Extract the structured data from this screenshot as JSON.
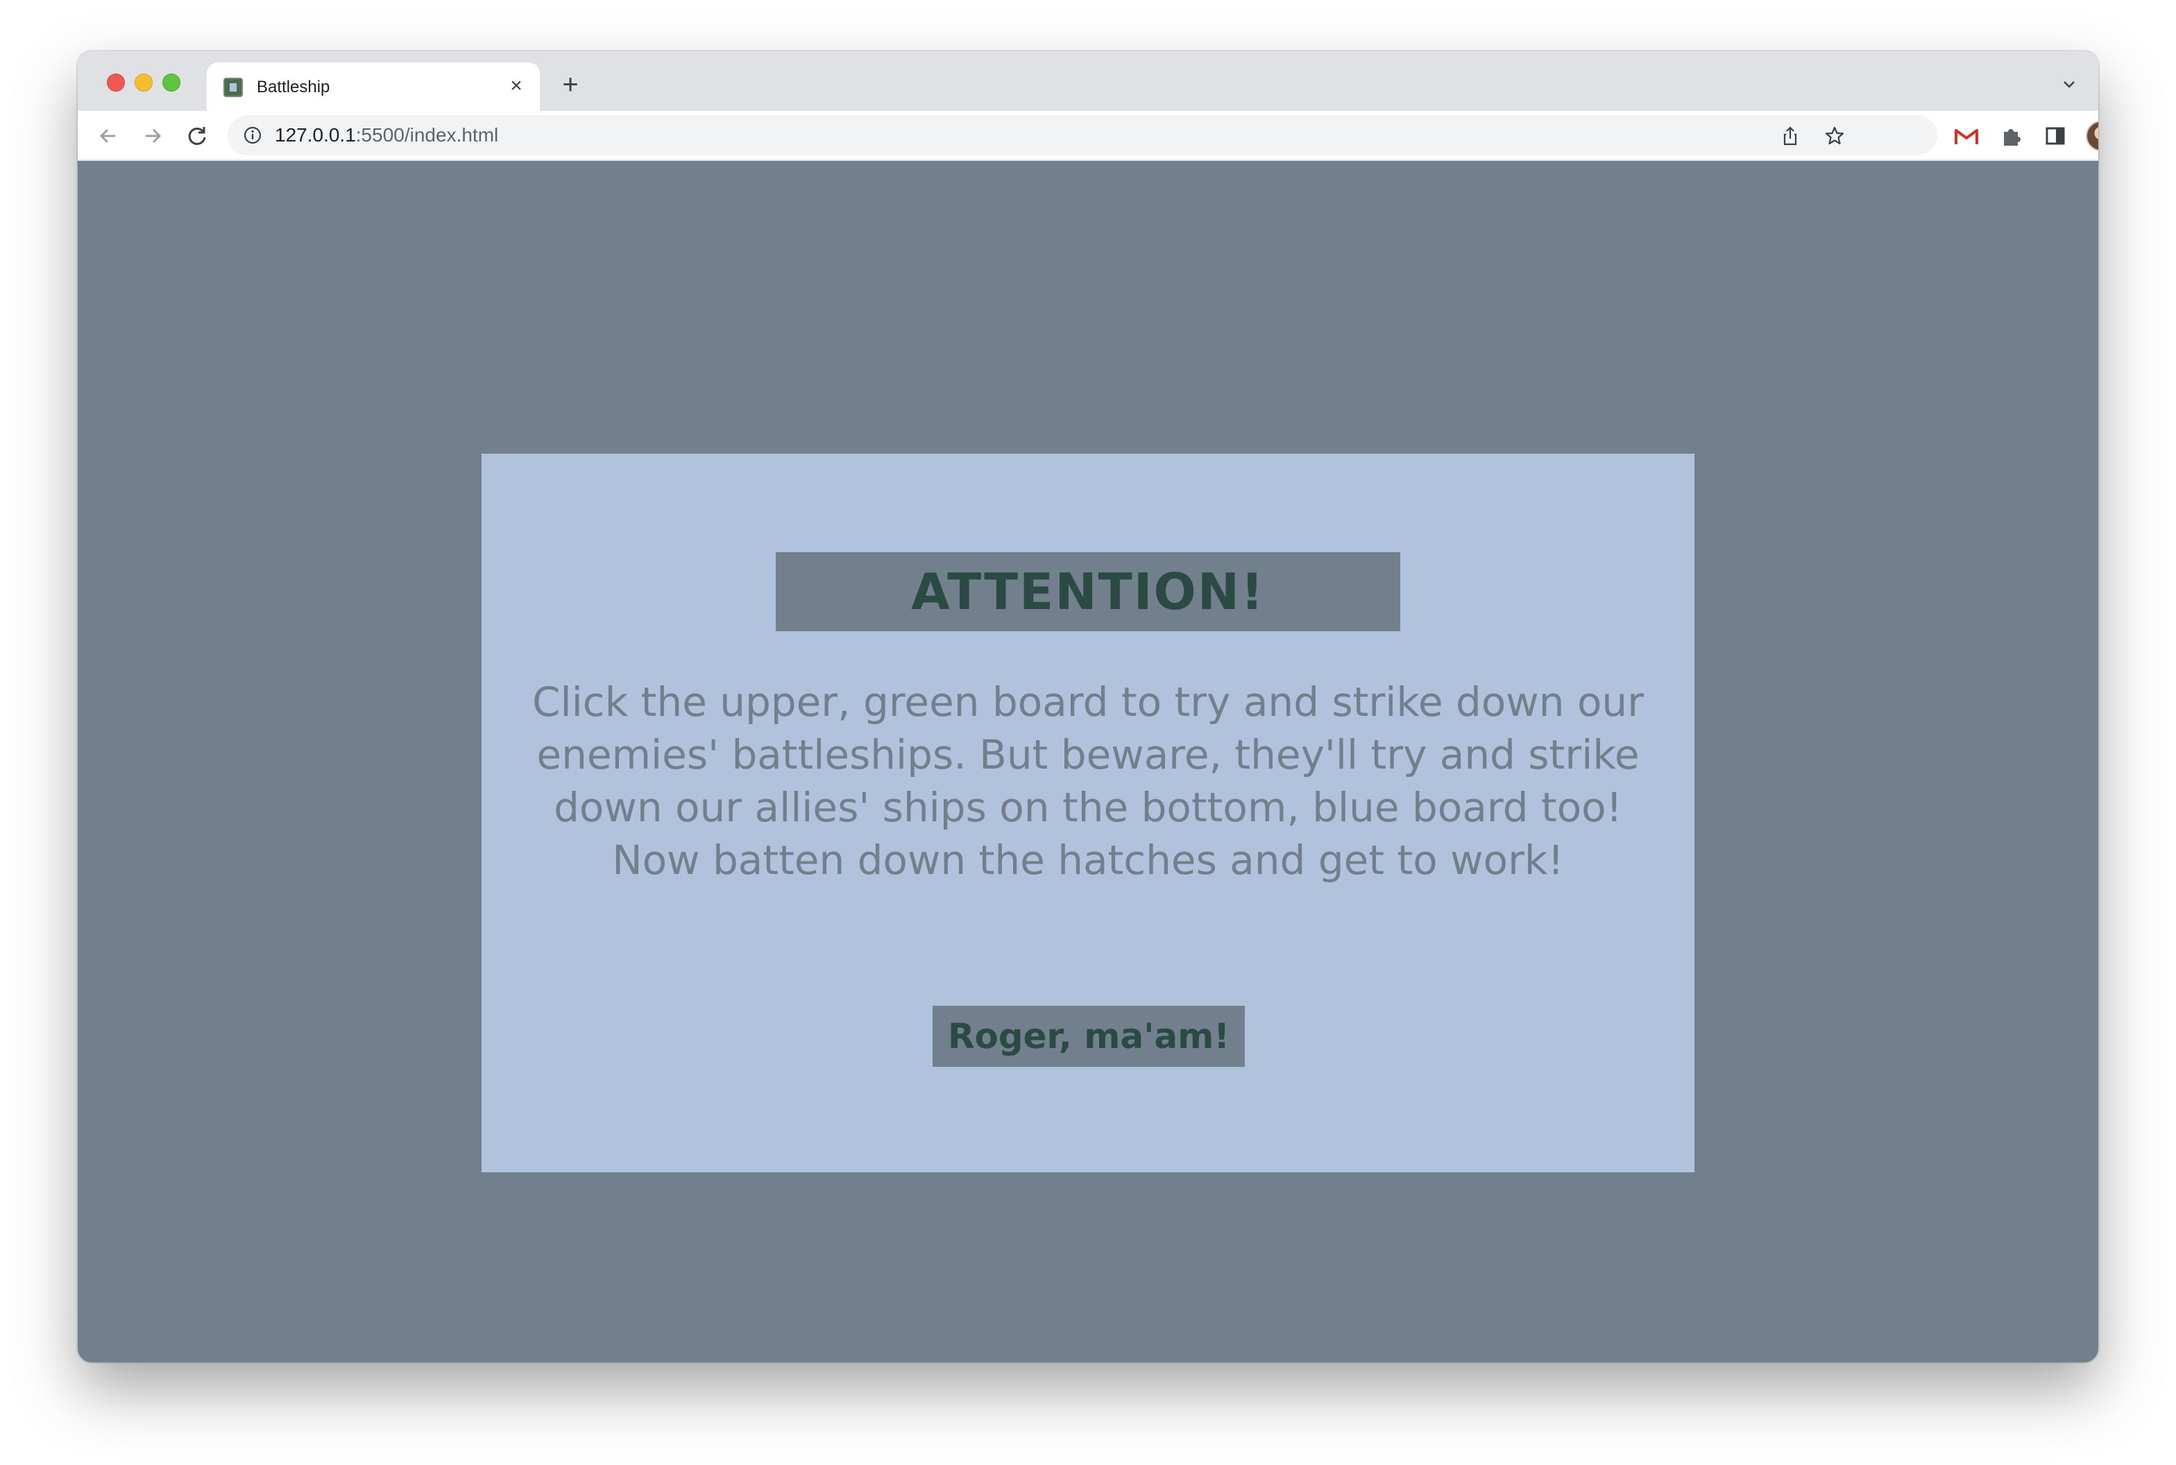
{
  "browser": {
    "tab": {
      "title": "Battleship",
      "close_glyph": "×"
    },
    "new_tab_glyph": "+",
    "address": {
      "host": "127.0.0.1",
      "rest": ":5500/index.html"
    },
    "icons": [
      "back-arrow-icon",
      "forward-arrow-icon",
      "reload-icon",
      "site-info-icon",
      "share-icon",
      "bookmark-star-icon",
      "gmail-icon",
      "extensions-icon",
      "side-panel-icon",
      "profile-avatar",
      "kebab-menu-icon",
      "tab-list-chevron-icon"
    ]
  },
  "page": {
    "colors": {
      "background": "#72808d",
      "modal": "#b0c2dc",
      "accent_text": "#2b4a43"
    },
    "modal": {
      "title": "ATTENTION!",
      "body": "Click the upper, green board to try and strike down our enemies' battleships. But beware, they'll try and strike down our allies' ships on the bottom, blue board too! Now batten down the hatches and get to work!",
      "button_label": "Roger, ma'am!"
    }
  }
}
